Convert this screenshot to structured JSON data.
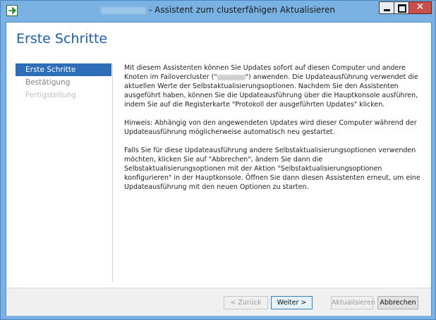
{
  "window": {
    "title": "- Assistent zum clusterfähigen Aktualisieren"
  },
  "page": {
    "title": "Erste Schritte"
  },
  "nav": {
    "items": [
      {
        "label": "Erste Schritte",
        "state": "active"
      },
      {
        "label": "Bestätigung",
        "state": "normal"
      },
      {
        "label": "Fertigstellung",
        "state": "disabled"
      }
    ]
  },
  "content": {
    "p1_a": "Mit diesem Assistenten können Sie Updates sofort auf diesen Computer und andere Knoten im Failovercluster (\"",
    "p1_b": "\") anwenden. Die Updateausführung verwendet die aktuellen Werte der Selbstaktualisierungsoptionen. Nachdem Sie den Assistenten ausgeführt haben, können Sie die Updateausführung über die Hauptkonsole ausführen, indem Sie auf die Registerkarte \"Protokoll der ausgeführten Updates\" klicken.",
    "p2": "Hinweis: Abhängig von den angewendeten Updates wird dieser Computer während der Updateausführung möglicherweise automatisch neu gestartet.",
    "p3": "Falls Sie für diese Updateausführung andere Selbstaktualisierungsoptionen verwenden möchten, klicken Sie auf \"Abbrechen\", ändern Sie dann die Selbstaktualisierungsoptionen mit der Aktion \"Selbstaktualisierungsoptionen konfigurieren\" in der Hauptkonsole. Öffnen Sie dann diesen Assistenten erneut, um eine Updateausführung mit den neuen Optionen zu starten."
  },
  "buttons": {
    "back": "< Zurück",
    "next": "Weiter >",
    "update": "Aktualisieren",
    "cancel": "Abbrechen"
  },
  "icons": {
    "app": "green-arrow-icon",
    "minimize": "minimize-icon",
    "maximize": "maximize-icon",
    "close": "close-icon"
  },
  "colors": {
    "title_bar": "#79b2e2",
    "accent": "#2e6db7",
    "heading": "#1f5fa3",
    "close": "#c7514a"
  }
}
